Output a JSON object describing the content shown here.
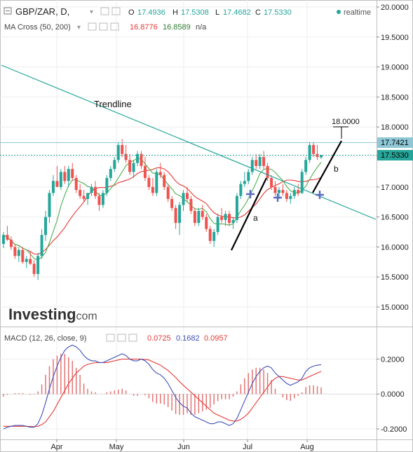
{
  "header": {
    "symbol": "GBP/ZAR, D,",
    "ohlc_o_label": "O",
    "ohlc_o": "17.4936",
    "ohlc_h_label": "H",
    "ohlc_h": "17.5308",
    "ohlc_l_label": "L",
    "ohlc_l": "17.4682",
    "ohlc_c_label": "C",
    "ohlc_c": "17.5330",
    "realtime": "realtime",
    "ma_title": "MA Cross (50, 200)",
    "ma_v1": "16.8776",
    "ma_v2": "16.8589",
    "ma_v3": "n/a"
  },
  "macd_header": {
    "title": "MACD (12, 26, close, 9)",
    "v1": "0.0725",
    "v2": "0.1682",
    "v3": "0.0957"
  },
  "watermark": {
    "bold": "Investing",
    "light": ".com"
  },
  "annotations": {
    "trendline": "Trendline",
    "a": "a",
    "b": "b",
    "target": "18.0000"
  },
  "colors": {
    "up": "#26a69a",
    "down": "#ef5350",
    "ma_fast": "#4caf50",
    "ma_slow": "#e53935",
    "trendline": "#26a69a",
    "macd_line": "#3f51b5",
    "signal_line": "#e53935",
    "hist": "#e57373",
    "level_line": "#26a69a",
    "cross": "#5c6bc0"
  },
  "chart_data": [
    {
      "type": "candlestick",
      "xlabel": "",
      "ylabel": "",
      "x_ticks": [
        "Apr",
        "May",
        "Jun",
        "Jul",
        "Aug"
      ],
      "y_ticks": [
        "20.0000",
        "19.5000",
        "19.0000",
        "18.5000",
        "18.0000",
        "17.5000",
        "17.0000",
        "16.5000",
        "16.0000",
        "15.5000",
        "15.0000"
      ],
      "ylim": [
        14.7,
        20.1
      ],
      "grid": true,
      "price_labels": [
        {
          "value": 17.7421,
          "text": "17.7421",
          "color": "#8ec7d6"
        },
        {
          "value": 17.533,
          "text": "17.5330",
          "color": "#26a69a"
        }
      ],
      "candles": [
        [
          16.05,
          16.25,
          15.98,
          16.2
        ],
        [
          16.2,
          16.35,
          16.1,
          16.12
        ],
        [
          16.12,
          16.18,
          15.95,
          16.0
        ],
        [
          16.0,
          16.05,
          15.8,
          15.85
        ],
        [
          15.85,
          16.0,
          15.75,
          15.95
        ],
        [
          15.95,
          16.0,
          15.72,
          15.75
        ],
        [
          15.75,
          15.85,
          15.65,
          15.8
        ],
        [
          15.8,
          15.92,
          15.7,
          15.72
        ],
        [
          15.72,
          15.78,
          15.5,
          15.55
        ],
        [
          15.55,
          15.9,
          15.45,
          15.85
        ],
        [
          15.85,
          16.3,
          15.8,
          16.2
        ],
        [
          16.2,
          16.6,
          16.1,
          16.5
        ],
        [
          16.5,
          16.95,
          16.4,
          16.9
        ],
        [
          16.9,
          17.2,
          16.85,
          17.1
        ],
        [
          17.1,
          17.35,
          17.0,
          17.0
        ],
        [
          17.0,
          17.3,
          16.95,
          17.25
        ],
        [
          17.25,
          17.35,
          17.05,
          17.1
        ],
        [
          17.1,
          17.35,
          17.0,
          17.3
        ],
        [
          17.3,
          17.4,
          17.1,
          17.15
        ],
        [
          17.15,
          17.2,
          16.9,
          16.95
        ],
        [
          16.95,
          17.05,
          16.8,
          16.85
        ],
        [
          16.85,
          16.95,
          16.75,
          16.8
        ],
        [
          16.8,
          16.9,
          16.7,
          16.9
        ],
        [
          16.9,
          17.05,
          16.85,
          17.0
        ],
        [
          17.0,
          17.1,
          16.8,
          16.85
        ],
        [
          16.85,
          16.9,
          16.6,
          16.7
        ],
        [
          16.7,
          16.95,
          16.65,
          16.9
        ],
        [
          16.9,
          17.2,
          16.85,
          17.15
        ],
        [
          17.15,
          17.35,
          17.1,
          17.3
        ],
        [
          17.3,
          17.5,
          17.25,
          17.45
        ],
        [
          17.45,
          17.75,
          17.4,
          17.7
        ],
        [
          17.7,
          17.8,
          17.5,
          17.55
        ],
        [
          17.55,
          17.7,
          17.4,
          17.45
        ],
        [
          17.45,
          17.55,
          17.2,
          17.25
        ],
        [
          17.25,
          17.45,
          17.15,
          17.4
        ],
        [
          17.4,
          17.6,
          17.35,
          17.55
        ],
        [
          17.55,
          17.6,
          17.3,
          17.35
        ],
        [
          17.35,
          17.5,
          17.1,
          17.15
        ],
        [
          17.15,
          17.2,
          16.95,
          17.0
        ],
        [
          17.0,
          17.15,
          16.85,
          16.9
        ],
        [
          16.9,
          17.3,
          16.85,
          17.25
        ],
        [
          17.25,
          17.4,
          17.15,
          17.2
        ],
        [
          17.2,
          17.25,
          16.95,
          17.0
        ],
        [
          17.0,
          17.05,
          16.75,
          16.8
        ],
        [
          16.8,
          16.85,
          16.6,
          16.65
        ],
        [
          16.65,
          16.7,
          16.3,
          16.4
        ],
        [
          16.4,
          16.75,
          16.2,
          16.7
        ],
        [
          16.7,
          16.95,
          16.6,
          16.9
        ],
        [
          16.9,
          17.0,
          16.75,
          16.8
        ],
        [
          16.8,
          16.85,
          16.55,
          16.6
        ],
        [
          16.6,
          16.65,
          16.35,
          16.4
        ],
        [
          16.4,
          16.65,
          16.35,
          16.6
        ],
        [
          16.6,
          16.7,
          16.45,
          16.5
        ],
        [
          16.5,
          16.55,
          16.25,
          16.3
        ],
        [
          16.3,
          16.35,
          16.05,
          16.1
        ],
        [
          16.1,
          16.3,
          16.0,
          16.25
        ],
        [
          16.25,
          16.55,
          16.2,
          16.5
        ],
        [
          16.5,
          16.65,
          16.4,
          16.45
        ],
        [
          16.45,
          16.6,
          16.35,
          16.55
        ],
        [
          16.55,
          16.6,
          16.35,
          16.4
        ],
        [
          16.4,
          16.5,
          16.3,
          16.45
        ],
        [
          16.45,
          16.9,
          16.4,
          16.85
        ],
        [
          16.85,
          17.1,
          16.8,
          17.05
        ],
        [
          17.05,
          17.25,
          17.0,
          17.1
        ],
        [
          17.1,
          17.3,
          17.05,
          17.25
        ],
        [
          17.25,
          17.5,
          17.2,
          17.45
        ],
        [
          17.45,
          17.55,
          17.3,
          17.35
        ],
        [
          17.35,
          17.55,
          17.3,
          17.5
        ],
        [
          17.5,
          17.6,
          17.3,
          17.35
        ],
        [
          17.35,
          17.4,
          17.1,
          17.15
        ],
        [
          17.15,
          17.2,
          16.95,
          17.0
        ],
        [
          17.0,
          17.1,
          16.85,
          16.9
        ],
        [
          16.9,
          17.0,
          16.8,
          16.95
        ],
        [
          16.95,
          17.05,
          16.85,
          16.9
        ],
        [
          16.9,
          16.95,
          16.75,
          16.8
        ],
        [
          16.8,
          16.9,
          16.72,
          16.85
        ],
        [
          16.85,
          17.0,
          16.8,
          16.95
        ],
        [
          16.95,
          17.05,
          16.85,
          16.9
        ],
        [
          16.9,
          17.3,
          16.88,
          17.25
        ],
        [
          17.25,
          17.5,
          17.2,
          17.45
        ],
        [
          17.45,
          17.75,
          17.4,
          17.7
        ],
        [
          17.7,
          17.75,
          17.5,
          17.55
        ],
        [
          17.55,
          17.7,
          17.45,
          17.5
        ],
        [
          17.4936,
          17.5308,
          17.4682,
          17.533
        ]
      ]
    },
    {
      "type": "line",
      "name": "MACD (12, 26, close, 9)",
      "x_ticks": [
        "Apr",
        "May",
        "Jun",
        "Jul",
        "Aug"
      ],
      "y_ticks": [
        "0.2000",
        "0.0000",
        "-0.2000"
      ],
      "ylim": [
        -0.26,
        0.29
      ],
      "grid": true,
      "macd": [
        -0.2,
        -0.19,
        -0.185,
        -0.18,
        -0.18,
        -0.18,
        -0.185,
        -0.19,
        -0.19,
        -0.17,
        -0.12,
        -0.05,
        0.03,
        0.1,
        0.16,
        0.21,
        0.25,
        0.27,
        0.28,
        0.27,
        0.25,
        0.22,
        0.2,
        0.19,
        0.19,
        0.18,
        0.18,
        0.19,
        0.2,
        0.21,
        0.22,
        0.23,
        0.22,
        0.2,
        0.19,
        0.19,
        0.2,
        0.19,
        0.17,
        0.14,
        0.12,
        0.11,
        0.09,
        0.06,
        0.02,
        -0.02,
        -0.05,
        -0.07,
        -0.08,
        -0.11,
        -0.13,
        -0.14,
        -0.15,
        -0.16,
        -0.17,
        -0.17,
        -0.16,
        -0.16,
        -0.17,
        -0.18,
        -0.17,
        -0.14,
        -0.09,
        -0.04,
        0.01,
        0.06,
        0.1,
        0.13,
        0.15,
        0.16,
        0.15,
        0.12,
        0.1,
        0.08,
        0.06,
        0.05,
        0.06,
        0.07,
        0.09,
        0.13,
        0.15,
        0.16,
        0.165,
        0.168
      ],
      "signal": [
        -0.185,
        -0.185,
        -0.185,
        -0.185,
        -0.185,
        -0.185,
        -0.185,
        -0.186,
        -0.187,
        -0.185,
        -0.175,
        -0.16,
        -0.13,
        -0.1,
        -0.06,
        -0.02,
        0.02,
        0.06,
        0.09,
        0.12,
        0.14,
        0.16,
        0.17,
        0.175,
        0.18,
        0.18,
        0.18,
        0.18,
        0.185,
        0.19,
        0.195,
        0.2,
        0.2,
        0.2,
        0.2,
        0.2,
        0.2,
        0.198,
        0.195,
        0.185,
        0.175,
        0.165,
        0.15,
        0.135,
        0.115,
        0.095,
        0.07,
        0.05,
        0.03,
        0.01,
        -0.01,
        -0.03,
        -0.05,
        -0.07,
        -0.09,
        -0.11,
        -0.12,
        -0.13,
        -0.14,
        -0.15,
        -0.155,
        -0.155,
        -0.145,
        -0.13,
        -0.11,
        -0.08,
        -0.05,
        -0.02,
        0.01,
        0.04,
        0.07,
        0.09,
        0.1,
        0.1,
        0.095,
        0.09,
        0.085,
        0.08,
        0.08,
        0.09,
        0.1,
        0.11,
        0.12,
        0.13
      ],
      "histogram": [
        -0.015,
        -0.005,
        0.0,
        0.005,
        0.005,
        0.005,
        0.0,
        -0.004,
        -0.003,
        0.015,
        0.055,
        0.11,
        0.16,
        0.2,
        0.22,
        0.23,
        0.23,
        0.21,
        0.19,
        0.15,
        0.11,
        0.06,
        0.03,
        0.015,
        0.01,
        0.0,
        0.0,
        0.01,
        0.015,
        0.02,
        0.025,
        0.03,
        0.02,
        0.0,
        -0.01,
        -0.01,
        0.0,
        -0.008,
        -0.025,
        -0.045,
        -0.055,
        -0.055,
        -0.06,
        -0.075,
        -0.095,
        -0.115,
        -0.12,
        -0.12,
        -0.11,
        -0.12,
        -0.12,
        -0.11,
        -0.1,
        -0.09,
        -0.08,
        -0.06,
        -0.04,
        -0.03,
        -0.03,
        -0.03,
        -0.015,
        0.015,
        0.055,
        0.09,
        0.12,
        0.14,
        0.15,
        0.15,
        0.14,
        0.12,
        0.08,
        0.03,
        0.0,
        -0.02,
        -0.035,
        -0.04,
        -0.025,
        -0.01,
        0.01,
        0.04,
        0.05,
        0.05,
        0.045,
        0.038
      ]
    }
  ]
}
